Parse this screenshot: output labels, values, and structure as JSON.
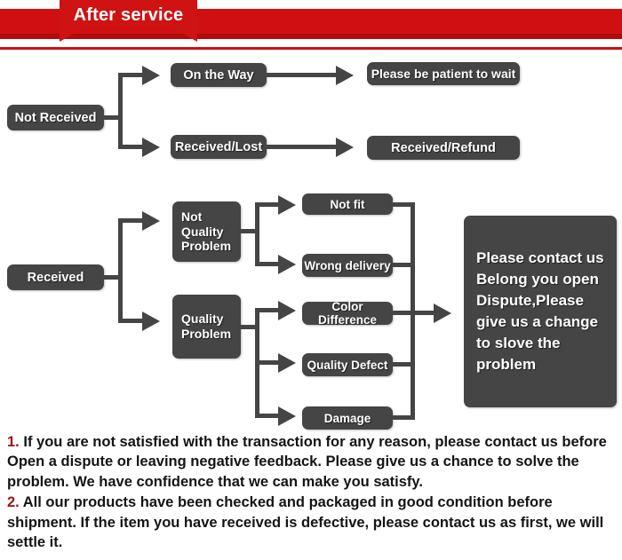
{
  "header": {
    "title": "After service",
    "accent_color": "#cf1212",
    "bar_color": "#d01010"
  },
  "flow_not_received": {
    "source": "Not Received",
    "branches": [
      {
        "status": "On the Way",
        "result": "Please be patient to wait"
      },
      {
        "status": "Received/Lost",
        "result": "Received/Refund"
      }
    ]
  },
  "flow_received": {
    "source": "Received",
    "categories": [
      {
        "label": "Not Quality Problem",
        "issues": [
          "Not fit",
          "Wrong delivery"
        ]
      },
      {
        "label": "Quality Problem",
        "issues": [
          "Color Difference",
          "Quality Defect",
          "Damage"
        ]
      }
    ],
    "issues_flat": [
      "Not fit",
      "Wrong delivery",
      "Color Difference",
      "Quality Defect",
      "Damage"
    ],
    "outcome": "Please contact us Belong you open Dispute,Please give us a change to slove the problem"
  },
  "notes": [
    {
      "number": "1.",
      "text": "If you are not satisfied with the transaction for any reason, please contact us before Open a dispute or leaving negative feedback. Please give us a chance to solve the problem. We have confidence that we can make you satisfy."
    },
    {
      "number": "2.",
      "text": "All our products have been checked and packaged in good condition before shipment. If the item you have received is defective, please contact us as first, we will settle it."
    }
  ],
  "colors": {
    "node_fill": "#454545",
    "note_number": "#a01515",
    "red": "#cc0f0f"
  }
}
